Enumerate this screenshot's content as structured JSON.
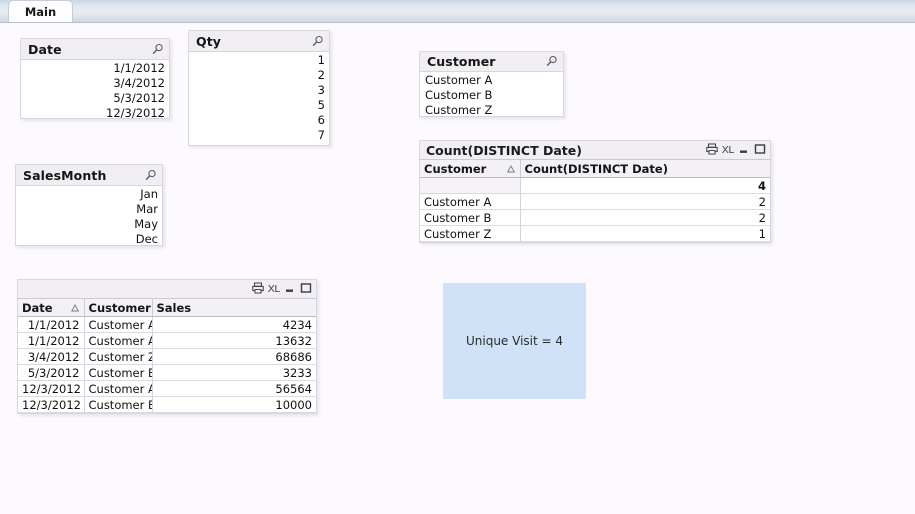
{
  "tabstrip": {
    "active_tab": "Main"
  },
  "listboxes": [
    {
      "id": "date",
      "title": "Date",
      "align": "right",
      "values": [
        "1/1/2012",
        "3/4/2012",
        "5/3/2012",
        "12/3/2012"
      ],
      "search_icon": "magnifier-icon"
    },
    {
      "id": "qty",
      "title": "Qty",
      "align": "right",
      "values": [
        "1",
        "2",
        "3",
        "5",
        "6",
        "7"
      ],
      "search_icon": "magnifier-icon"
    },
    {
      "id": "salesmonth",
      "title": "SalesMonth",
      "align": "right",
      "values": [
        "Jan",
        "Mar",
        "May",
        "Dec"
      ],
      "search_icon": "magnifier-icon"
    },
    {
      "id": "customer",
      "title": "Customer",
      "align": "left",
      "values": [
        "Customer A",
        "Customer B",
        "Customer Z"
      ],
      "search_icon": "magnifier-icon"
    }
  ],
  "count_table": {
    "title": "Count(DISTINCT  Date)",
    "icons": [
      "print-icon",
      "excel-export-icon",
      "minimize-icon",
      "maximize-icon"
    ],
    "icon_labels": {
      "excel": "XL"
    },
    "columns": [
      "Customer",
      "Count(DISTINCT Date)"
    ],
    "sorted_column": "Customer",
    "total_row": {
      "label": "",
      "value": "4"
    },
    "rows": [
      {
        "customer": "Customer A",
        "count": "2"
      },
      {
        "customer": "Customer B",
        "count": "2"
      },
      {
        "customer": "Customer Z",
        "count": "1"
      }
    ]
  },
  "sales_table": {
    "title": "",
    "icons": [
      "print-icon",
      "excel-export-icon",
      "minimize-icon",
      "maximize-icon"
    ],
    "icon_labels": {
      "excel": "XL"
    },
    "columns": [
      "Date",
      "Customer",
      "Sales"
    ],
    "sorted_column": "Date",
    "rows": [
      {
        "date": "1/1/2012",
        "customer": "Customer A",
        "sales": "4234"
      },
      {
        "date": "1/1/2012",
        "customer": "Customer A",
        "sales": "13632"
      },
      {
        "date": "3/4/2012",
        "customer": "Customer Z",
        "sales": "68686"
      },
      {
        "date": "5/3/2012",
        "customer": "Customer B",
        "sales": "3233"
      },
      {
        "date": "12/3/2012",
        "customer": "Customer A",
        "sales": "56564"
      },
      {
        "date": "12/3/2012",
        "customer": "Customer B",
        "sales": "10000"
      }
    ]
  },
  "text_object": {
    "text": "Unique Visit = 4",
    "background_color": "#cfe2f7"
  },
  "colors": {
    "page_background": "#fdfaff",
    "caption_background": "#f0eef2",
    "tab_gradient_top": "#ccd7e4",
    "tab_gradient_bottom": "#cfd8e2",
    "textbox_blue": "#cfe2f7"
  }
}
